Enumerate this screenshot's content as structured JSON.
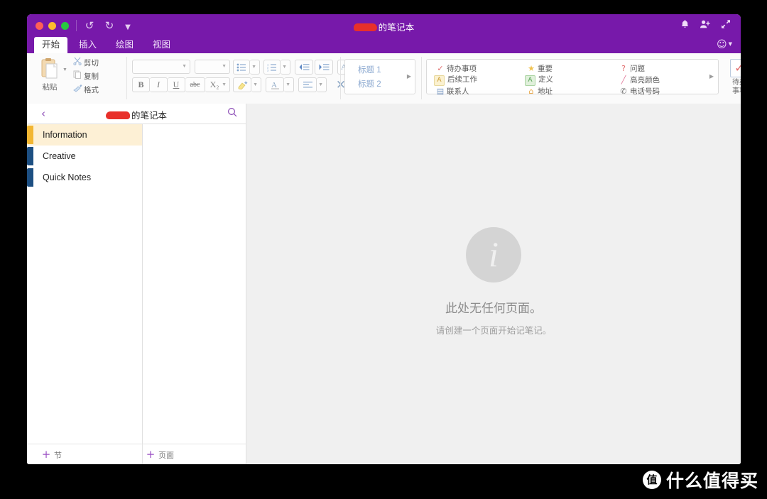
{
  "window": {
    "title": "的笔记本",
    "title_has_redaction": true,
    "traffic_lights": [
      "close",
      "minimize",
      "maximize"
    ],
    "quick_access": [
      {
        "name": "undo-icon",
        "glyph": "↺"
      },
      {
        "name": "redo-icon",
        "glyph": "↻"
      },
      {
        "name": "qat-more-icon",
        "glyph": "▼"
      }
    ],
    "right_icons": [
      {
        "name": "bell-icon",
        "glyph": "🔔"
      },
      {
        "name": "add-user-icon",
        "glyph": "👤+"
      },
      {
        "name": "expand-icon",
        "glyph": "⤢"
      }
    ],
    "emoji_button": {
      "glyph": "☺",
      "caret": "▼"
    }
  },
  "tabs": [
    {
      "label": "开始",
      "active": true
    },
    {
      "label": "插入",
      "active": false
    },
    {
      "label": "绘图",
      "active": false
    },
    {
      "label": "视图",
      "active": false
    }
  ],
  "ribbon": {
    "paste": {
      "label": "粘贴",
      "caret": "▼"
    },
    "clipboard": [
      {
        "label": "剪切",
        "icon": "✂"
      },
      {
        "label": "复制",
        "icon": "⧉"
      },
      {
        "label": "格式",
        "icon": "🖌"
      }
    ],
    "font": {
      "font_name_value": "",
      "font_size_value": "",
      "bold": "B",
      "italic": "I",
      "underline": "U",
      "strikethrough": "abc",
      "subscript": "X₂"
    },
    "paragraph": {
      "bullets": "☷",
      "numbering": "☰",
      "outdent": "⇤",
      "indent": "⇥",
      "clear_formatting": "A",
      "highlight": "✎",
      "font_color": "A",
      "align": "≡",
      "remove_formatting": "✕"
    },
    "styles": {
      "items": [
        "标题 1",
        "标题 2"
      ],
      "more": "▶"
    },
    "tags": {
      "items": [
        {
          "label": "待办事项",
          "icon": "✓",
          "color": "#e06666"
        },
        {
          "label": "后续工作",
          "icon": "A",
          "color": "#d8a53c"
        },
        {
          "label": "联系人",
          "icon": "▤",
          "color": "#7f9dc4"
        },
        {
          "label": "重要",
          "icon": "★",
          "color": "#f0c14b"
        },
        {
          "label": "定义",
          "icon": "A",
          "color": "#72b772"
        },
        {
          "label": "地址",
          "icon": "⌂",
          "color": "#e8a33d"
        },
        {
          "label": "问题",
          "icon": "?",
          "color": "#e06666"
        },
        {
          "label": "高亮颜色",
          "icon": "╱",
          "color": "#e27a9a"
        },
        {
          "label": "电话号码",
          "icon": "✆",
          "color": "#6a6a6a"
        }
      ],
      "more": "▶"
    },
    "todo_button": {
      "label": "待办\n事项",
      "label_line1": "待办",
      "label_line2": "事项",
      "icon": "✓"
    }
  },
  "navigation": {
    "back_chevron": "‹",
    "notebook_title": "的笔记本",
    "notebook_title_has_redaction": true,
    "search_icon": "⚲",
    "sections": [
      {
        "label": "Information",
        "color": "#f2b632",
        "selected": true
      },
      {
        "label": "Creative",
        "color": "#1d4f82",
        "selected": false
      },
      {
        "label": "Quick Notes",
        "color": "#1d4f82",
        "selected": false
      }
    ],
    "pages": [],
    "add_section": {
      "label": "节",
      "plus": "+"
    },
    "add_page": {
      "label": "页面",
      "plus": "+"
    }
  },
  "canvas": {
    "empty_icon": "i",
    "empty_title": "此处无任何页面。",
    "empty_subtitle": "请创建一个页面开始记笔记。"
  },
  "watermark": {
    "badge": "值",
    "text": "什么值得买"
  },
  "colors": {
    "brand_purple": "#7719aa",
    "accent_purple": "#9b51c4",
    "selected_section_bg": "#fdf0d5",
    "canvas_bg": "#f0f0f0"
  }
}
